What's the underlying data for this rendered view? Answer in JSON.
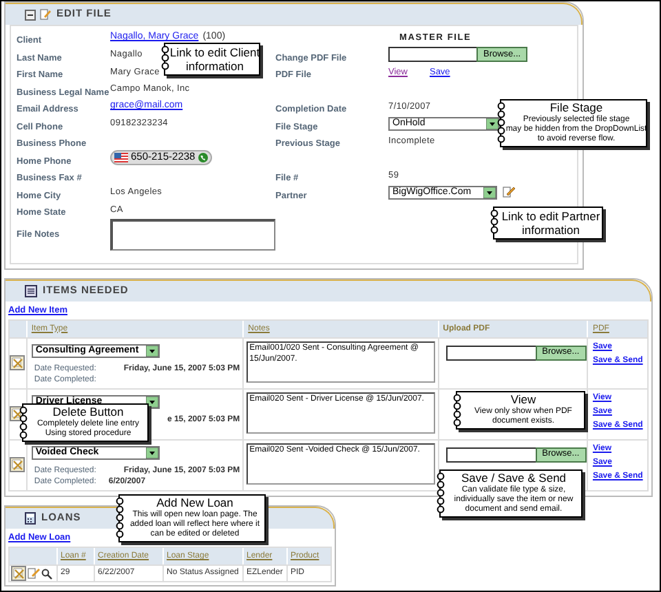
{
  "edit_file": {
    "title": "EDIT FILE",
    "rows": [
      {
        "left": {
          "label": "Client",
          "kind": "link",
          "value": "Nagallo, Mary Grace",
          "suffix": "(100)"
        },
        "right": {
          "kind": "heading",
          "value": "MASTER FILE"
        }
      },
      {
        "left": {
          "label": "Last Name",
          "kind": "text",
          "value": "Nagallo"
        },
        "right": {
          "label": "Change PDF File",
          "kind": "file",
          "value": "Browse..."
        }
      },
      {
        "left": {
          "label": "First Name",
          "kind": "text",
          "value": "Mary Grace"
        },
        "right": {
          "label": "PDF File",
          "kind": "links",
          "links": [
            "View",
            "Save"
          ]
        }
      },
      {
        "left": {
          "label": "Business Legal Name",
          "kind": "text",
          "value": "Campo Manok, Inc"
        },
        "right": {
          "kind": "none"
        }
      },
      {
        "left": {
          "label": "Email Address",
          "kind": "link",
          "value": "grace@mail.com"
        },
        "right": {
          "label": "Completion Date",
          "kind": "text",
          "value": "7/10/2007"
        }
      },
      {
        "left": {
          "label": "Cell Phone",
          "kind": "text",
          "value": "09182323234"
        },
        "right": {
          "label": "File Stage",
          "kind": "select",
          "value": "OnHold"
        }
      },
      {
        "left": {
          "label": "Business Phone",
          "kind": "text"
        },
        "right": {
          "label": "Previous Stage",
          "kind": "text",
          "value": "Incomplete"
        }
      },
      {
        "left": {
          "label": "Home Phone",
          "kind": "phone",
          "value": "650-215-2238"
        },
        "right": {
          "kind": "none"
        }
      },
      {
        "left": {
          "label": "Business Fax #",
          "kind": "text"
        },
        "right": {
          "label": "File #",
          "kind": "text",
          "value": "59"
        }
      },
      {
        "left": {
          "label": "Home City",
          "kind": "text",
          "value": "Los Angeles"
        },
        "right": {
          "label": "Partner",
          "kind": "select_edit",
          "value": "BigWigOffice.Com"
        }
      },
      {
        "left": {
          "label": "Home State",
          "kind": "text",
          "value": "CA"
        },
        "right": {
          "kind": "none"
        }
      },
      {
        "left": {
          "label": "File Notes",
          "kind": "textarea"
        },
        "right": {
          "kind": "none"
        }
      }
    ]
  },
  "items_needed": {
    "title": "ITEMS NEEDED",
    "add_link": "Add New Item",
    "columns": [
      "Item Type",
      "Notes",
      "Upload PDF",
      "PDF"
    ],
    "rows": [
      {
        "item_type": "Consulting Agreement",
        "date_requested_label": "Date Requested:",
        "date_requested": "Friday, June 15, 2007 5:03 PM",
        "date_completed_label": "Date Completed:",
        "notes": "Email001/020 Sent - Consulting Agreement @ 15/Jun/2007.",
        "browse": "Browse...",
        "pdf_links": [
          "Save",
          "Save & Send"
        ]
      },
      {
        "item_type": "Driver License",
        "date_requested": "e 15, 2007 5:03 PM",
        "notes": "Email020 Sent - Driver License @ 15/Jun/2007.",
        "pdf_links": [
          "View",
          "Save",
          "Save & Send"
        ]
      },
      {
        "item_type": "Voided Check",
        "date_requested_label": "Date Requested:",
        "date_requested": "Friday, June 15, 2007 5:03 PM",
        "date_completed_label": "Date Completed:",
        "date_completed": "6/20/2007",
        "notes": "Email020 Sent -Voided Check @ 15/Jun/2007.",
        "browse": "Browse...",
        "pdf_links": [
          "View",
          "Save",
          "Save & Send"
        ]
      }
    ]
  },
  "loans": {
    "title": "LOANS",
    "add_link": "Add New Loan",
    "columns": [
      "Loan #",
      "Creation Date",
      "Loan Stage",
      "Lender",
      "Product"
    ],
    "rows": [
      {
        "cells": [
          "29",
          "6/22/2007",
          "No Status Assigned",
          "EZLender",
          "PID"
        ]
      }
    ]
  },
  "callouts": [
    {
      "body": [
        "Link to edit Client",
        "information"
      ]
    },
    {
      "title": "File Stage",
      "body": [
        "Previously selected file stage",
        "may be hidden from the DropDownList",
        "to avoid reverse flow."
      ]
    },
    {
      "body": [
        "Link to edit Partner",
        "information"
      ]
    },
    {
      "title": "Delete Button",
      "body": [
        "Completely delete line entry",
        "Using stored procedure"
      ]
    },
    {
      "title": "View",
      "body": [
        "View only show when PDF",
        "document exists."
      ]
    },
    {
      "title": "Save / Save & Send",
      "body": [
        "Can validate file type & size,",
        "individually save the item or new",
        "document and send email."
      ]
    },
    {
      "title": "Add New Loan",
      "body": [
        "This will open new loan page. The",
        "added loan will reflect here where it",
        "can be edited or deleted"
      ]
    }
  ]
}
